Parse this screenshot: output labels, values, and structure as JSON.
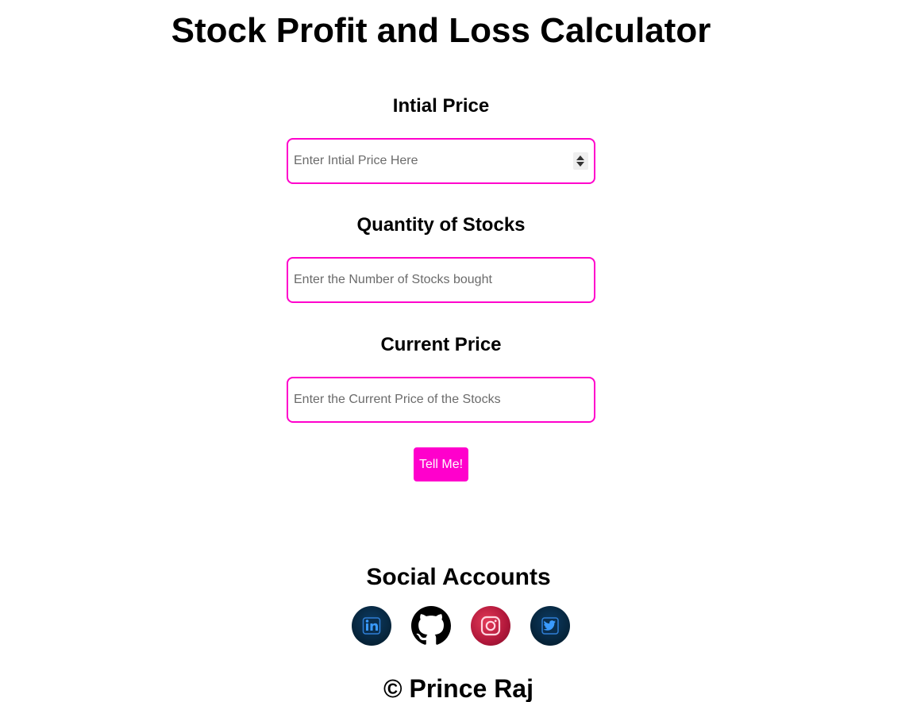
{
  "header": {
    "title": "Stock Profit and Loss Calculator"
  },
  "form": {
    "initial_price": {
      "label": "Intial Price",
      "placeholder": "Enter Intial Price Here",
      "value": ""
    },
    "quantity": {
      "label": "Quantity of Stocks",
      "placeholder": "Enter the Number of Stocks bought",
      "value": ""
    },
    "current_price": {
      "label": "Current Price",
      "placeholder": "Enter the Current Price of the Stocks",
      "value": ""
    },
    "submit_label": "Tell Me!"
  },
  "social": {
    "title": "Social Accounts",
    "icons": [
      "linkedin-icon",
      "github-icon",
      "instagram-icon",
      "twitter-icon"
    ]
  },
  "footer": {
    "copyright": "© Prince Raj"
  },
  "colors": {
    "accent": "#ff00cc",
    "text": "#000000",
    "placeholder": "#6b6b6b",
    "background": "#ffffff"
  }
}
